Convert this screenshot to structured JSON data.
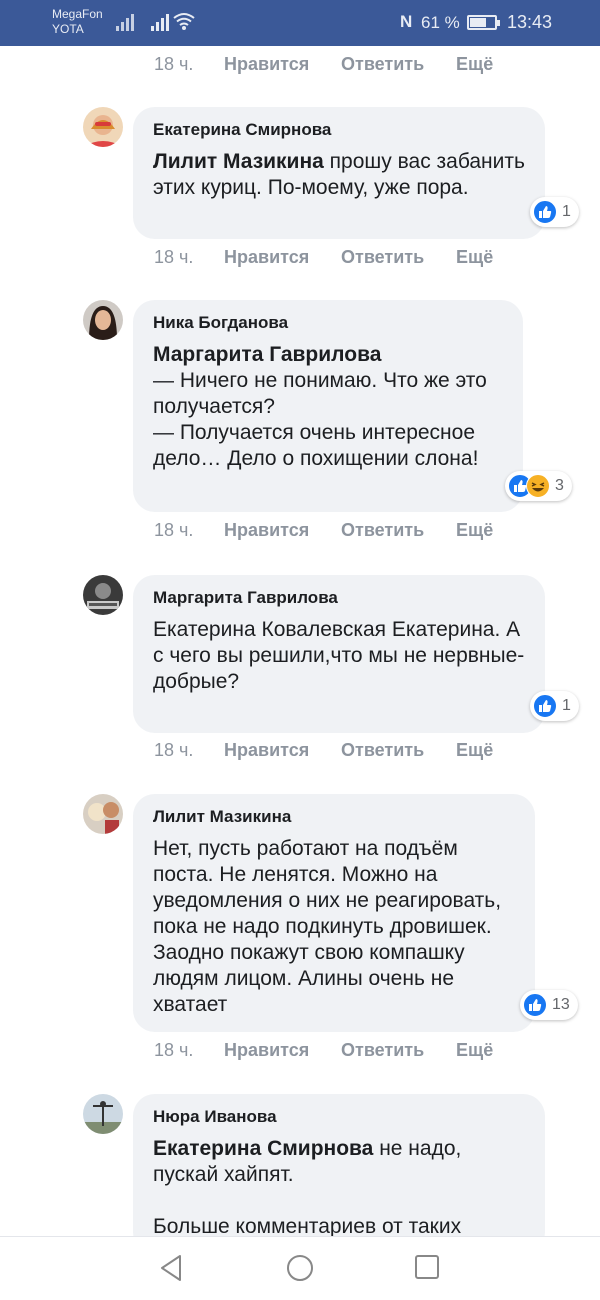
{
  "status_bar": {
    "carrier_primary": "MegaFon",
    "carrier_secondary": "YOTA",
    "battery_percent": "61 %",
    "battery_level": 0.61,
    "time": "13:43",
    "nfc_label": "N"
  },
  "top_actions": {
    "time": "18 ч.",
    "like": "Нравится",
    "reply": "Ответить",
    "more": "Ещё"
  },
  "comments": [
    {
      "author": "Екатерина Смирнова",
      "mention": "Лилит Мазикина",
      "text": " прошу вас забанить этих куриц. По-моему, уже пора.",
      "reaction_count": "1",
      "reactions": [
        "like"
      ],
      "time": "18 ч.",
      "like": "Нравится",
      "reply": "Ответить",
      "more": "Ещё"
    },
    {
      "author": "Ника Богданова",
      "mention": "Маргарита Гаврилова",
      "text": "— Ничего не понимаю. Что же это получается?\n— Получается очень интересное дело… Дело о похищении слона!",
      "reaction_count": "3",
      "reactions": [
        "like",
        "haha"
      ],
      "time": "18 ч.",
      "like": "Нравится",
      "reply": "Ответить",
      "more": "Ещё"
    },
    {
      "author": "Маргарита Гаврилова",
      "text": "Екатерина Ковалевская Екатерина. А с чего вы решили,что мы не нервные-добрые?",
      "reaction_count": "1",
      "reactions": [
        "like"
      ],
      "time": "18 ч.",
      "like": "Нравится",
      "reply": "Ответить",
      "more": "Ещё"
    },
    {
      "author": "Лилит Мазикина",
      "text": "Нет, пусть работают на подъём поста. Не ленятся. Можно на уведомления о них не реагировать, пока не надо подкинуть дровишек. Заодно покажут свою компашку людям лицом. Алины очень не хватает",
      "reaction_count": "13",
      "reactions": [
        "like"
      ],
      "time": "18 ч.",
      "like": "Нравится",
      "reply": "Ответить",
      "more": "Ещё"
    },
    {
      "author": "Нюра Иванова",
      "mention": "Екатерина Смирнова",
      "text": " не надо, пускай хайпят.",
      "text2": "Больше комментариев от таких"
    }
  ],
  "nav": {
    "back_icon": "back-triangle-icon",
    "home_icon": "home-circle-icon",
    "recents_icon": "recents-square-icon"
  },
  "colors": {
    "status_bar": "#3b5998",
    "bubble": "#f0f2f5",
    "like_blue": "#1877f2",
    "meta_gray": "#8d949e"
  }
}
